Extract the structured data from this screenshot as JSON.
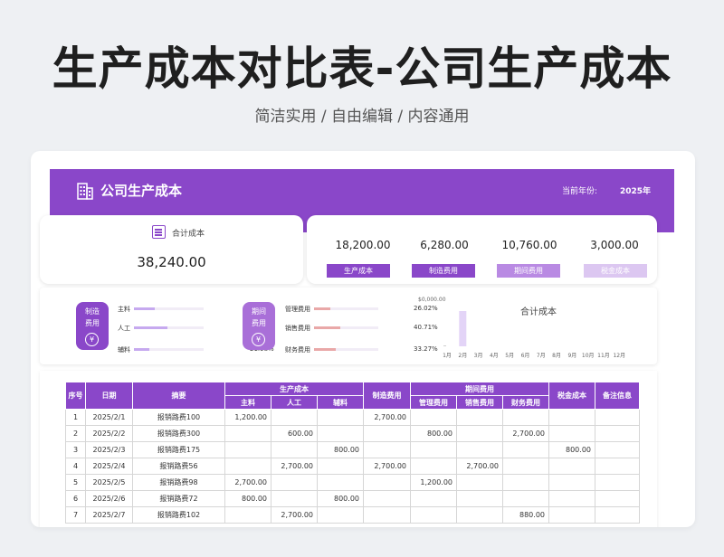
{
  "hero": {
    "title": "生产成本对比表-公司生产成本",
    "subtitle": "简洁实用 / 自由编辑 / 内容通用"
  },
  "banner": {
    "company": "公司生产成本",
    "year_label": "当前年份:",
    "year_value": "2025年"
  },
  "total": {
    "label": "合计成本",
    "value": "38,240.00",
    "icon": "ledger-icon"
  },
  "categories": [
    {
      "value": "18,200.00",
      "label": "生产成本"
    },
    {
      "value": "6,280.00",
      "label": "制造费用"
    },
    {
      "value": "10,760.00",
      "label": "期间费用"
    },
    {
      "value": "3,000.00",
      "label": "税金成本"
    }
  ],
  "breakdown": {
    "manufacture": {
      "tile": [
        "制造",
        "费用"
      ],
      "rows": [
        {
          "label": "主料",
          "pct": "30.22%",
          "frac": 0.3022
        },
        {
          "label": "人工",
          "pct": "47.80%",
          "frac": 0.478
        },
        {
          "label": "辅料",
          "pct": "21.98%",
          "frac": 0.2198
        }
      ]
    },
    "period": {
      "tile": [
        "期间",
        "费用"
      ],
      "rows": [
        {
          "label": "管理费用",
          "pct": "26.02%",
          "frac": 0.2602
        },
        {
          "label": "销售费用",
          "pct": "40.71%",
          "frac": 0.4071
        },
        {
          "label": "财务费用",
          "pct": "33.27%",
          "frac": 0.3327
        }
      ]
    }
  },
  "chart_data": {
    "type": "bar",
    "title": "合计成本",
    "y_max_label": "$0,000.00",
    "categories": [
      "1月",
      "2月",
      "3月",
      "4月",
      "5月",
      "6月",
      "7月",
      "8月",
      "9月",
      "10月",
      "11月",
      "12月"
    ],
    "values": [
      400,
      38240,
      0,
      0,
      0,
      0,
      0,
      0,
      0,
      0,
      0,
      0
    ],
    "ylim": [
      0,
      50000
    ]
  },
  "table": {
    "group_headers": {
      "prod": "生产成本",
      "period": "期间费用"
    },
    "headers": {
      "idx": "序号",
      "date": "日期",
      "summary": "摘要",
      "mat": "主料",
      "labor": "人工",
      "aux": "辅料",
      "mfg": "制造费用",
      "mgmt": "管理费用",
      "sales": "销售费用",
      "fin": "财务费用",
      "tax": "税金成本",
      "note": "备注信息"
    },
    "rows": [
      {
        "idx": "1",
        "date": "2025/2/1",
        "summary": "报销路费100",
        "mat": "1,200.00",
        "labor": "",
        "aux": "",
        "mfg": "2,700.00",
        "mgmt": "",
        "sales": "",
        "fin": "",
        "tax": "",
        "note": ""
      },
      {
        "idx": "2",
        "date": "2025/2/2",
        "summary": "报销路费300",
        "mat": "",
        "labor": "600.00",
        "aux": "",
        "mfg": "",
        "mgmt": "800.00",
        "sales": "",
        "fin": "2,700.00",
        "tax": "",
        "note": ""
      },
      {
        "idx": "3",
        "date": "2025/2/3",
        "summary": "报销路费175",
        "mat": "",
        "labor": "",
        "aux": "800.00",
        "mfg": "",
        "mgmt": "",
        "sales": "",
        "fin": "",
        "tax": "800.00",
        "note": ""
      },
      {
        "idx": "4",
        "date": "2025/2/4",
        "summary": "报销路费56",
        "mat": "",
        "labor": "2,700.00",
        "aux": "",
        "mfg": "2,700.00",
        "mgmt": "",
        "sales": "2,700.00",
        "fin": "",
        "tax": "",
        "note": ""
      },
      {
        "idx": "5",
        "date": "2025/2/5",
        "summary": "报销路费98",
        "mat": "2,700.00",
        "labor": "",
        "aux": "",
        "mfg": "",
        "mgmt": "1,200.00",
        "sales": "",
        "fin": "",
        "tax": "",
        "note": ""
      },
      {
        "idx": "6",
        "date": "2025/2/6",
        "summary": "报销路费72",
        "mat": "800.00",
        "labor": "",
        "aux": "800.00",
        "mfg": "",
        "mgmt": "",
        "sales": "",
        "fin": "",
        "tax": "",
        "note": ""
      },
      {
        "idx": "7",
        "date": "2025/2/7",
        "summary": "报销路费102",
        "mat": "",
        "labor": "2,700.00",
        "aux": "",
        "mfg": "",
        "mgmt": "",
        "sales": "",
        "fin": "880.00",
        "tax": "",
        "note": ""
      }
    ]
  },
  "colors": {
    "accent": "#8a47c9",
    "accent_light": "#b98ae3",
    "accent_pale": "#dcc7f1",
    "bar_purple": "#c6a9ef",
    "bar_red": "#e9a8a8"
  }
}
